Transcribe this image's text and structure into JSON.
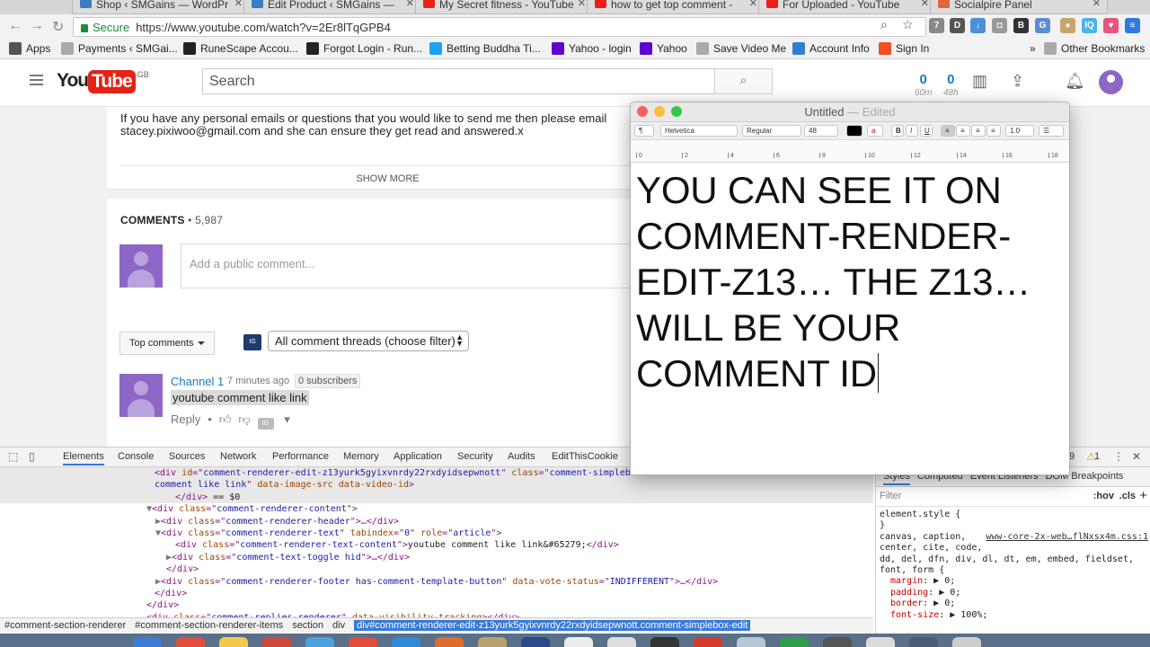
{
  "browser": {
    "tabs": [
      {
        "title": "Shop ‹ SMGains — WordPr",
        "favicon_color": "#3b7bbf"
      },
      {
        "title": "Edit Product ‹ SMGains —",
        "favicon_color": "#3b7bbf"
      },
      {
        "title": "My Secret fitness - YouTube",
        "favicon_color": "#e62117"
      },
      {
        "title": "how to get top comment -",
        "favicon_color": "#e62117"
      },
      {
        "title": "For Uploaded - YouTube",
        "favicon_color": "#e62117"
      },
      {
        "title": "Socialpire Panel",
        "favicon_color": "#e2643f"
      }
    ],
    "secure_label": "Secure",
    "url": "https://www.youtube.com/watch?v=2Er8lTqGPB4",
    "bookmarks": [
      {
        "label": "Apps",
        "icon": "apps-grid-icon",
        "color": "#555555"
      },
      {
        "label": "Payments ‹ SMGai...",
        "icon": "page-icon",
        "color": "#aaaaaa"
      },
      {
        "label": "RuneScape Accou...",
        "icon": "runescape-icon",
        "color": "#222222"
      },
      {
        "label": "Forgot Login - Run...",
        "icon": "runescape-icon",
        "color": "#222222"
      },
      {
        "label": "Betting Buddha Ti...",
        "icon": "twitter-icon",
        "color": "#1da1f2"
      },
      {
        "label": "Yahoo - login",
        "icon": "yahoo-icon",
        "color": "#5f01d1"
      },
      {
        "label": "Yahoo",
        "icon": "yahoo-icon",
        "color": "#5f01d1"
      },
      {
        "label": "Save Video Me",
        "icon": "page-icon",
        "color": "#aaaaaa"
      },
      {
        "label": "Account Info",
        "icon": "aol-icon",
        "color": "#2f80d1"
      },
      {
        "label": "Sign In",
        "icon": "microsoft-icon",
        "color": "#f25022"
      }
    ],
    "overflow_label": "»",
    "other_bookmarks": "Other Bookmarks"
  },
  "youtube": {
    "logo_you": "You",
    "logo_tube": "Tube",
    "logo_region": "GB",
    "search_placeholder": "Search",
    "stats": [
      {
        "value": "0",
        "label": "60m"
      },
      {
        "value": "0",
        "label": "48h"
      }
    ],
    "description": "If you have any personal emails or questions that you would like to send me then please email stacey.pixiwoo@gmail.com and she can ensure they get read and answered.x",
    "show_more": "SHOW MORE",
    "comments_label": "COMMENTS",
    "comments_count": " • 5,987",
    "add_comment_placeholder": "Add a public comment...",
    "sort_label": "Top comments",
    "filter_icon_text": "IG",
    "filter_label": "All comment threads (choose filter)",
    "comment": {
      "author": "Channel 1",
      "time": "7 minutes ago",
      "subscribers": "0 subscribers",
      "text": "youtube comment like link",
      "reply": "Reply",
      "separator": "•"
    },
    "colors": {
      "brand_red": "#e62117",
      "link_blue": "#167ac6",
      "avatar_purple": "#8e67c6"
    }
  },
  "devtools": {
    "tabs": [
      "Elements",
      "Console",
      "Sources",
      "Network",
      "Performance",
      "Memory",
      "Application",
      "Security",
      "Audits",
      "EditThisCookie"
    ],
    "warning_count": "1",
    "error_count": "9",
    "code_lines": [
      {
        "indent": 172,
        "parts": [
          [
            "tag",
            "<div "
          ],
          [
            "attr",
            "id"
          ],
          [
            "tag",
            "=\""
          ],
          [
            "val",
            "comment-renderer-edit-z13yurk5gyixvnrdy22rxdyidsepwnott"
          ],
          [
            "tag",
            "\" "
          ],
          [
            "attr",
            "class"
          ],
          [
            "tag",
            "=\""
          ],
          [
            "val",
            "comment-simplebox"
          ]
        ],
        "sel": true
      },
      {
        "indent": 172,
        "parts": [
          [
            "val",
            "comment like link"
          ],
          [
            "tag",
            "\" "
          ],
          [
            "attr",
            "data-image-src data-video-id"
          ],
          [
            "tag",
            ">"
          ]
        ],
        "sel": true
      },
      {
        "indent": 195,
        "parts": [
          [
            "tag",
            "</div>"
          ],
          [
            "txt",
            " == $0"
          ]
        ],
        "sel": true
      },
      {
        "indent": 163,
        "parts": [
          [
            "tri",
            "▼"
          ],
          [
            "tag",
            "<div "
          ],
          [
            "attr",
            "class"
          ],
          [
            "tag",
            "=\""
          ],
          [
            "val",
            "comment-renderer-content"
          ],
          [
            "tag",
            "\">"
          ]
        ]
      },
      {
        "indent": 173,
        "parts": [
          [
            "tri",
            "▶"
          ],
          [
            "tag",
            "<div "
          ],
          [
            "attr",
            "class"
          ],
          [
            "tag",
            "=\""
          ],
          [
            "val",
            "comment-renderer-header"
          ],
          [
            "tag",
            "\">…</div>"
          ]
        ]
      },
      {
        "indent": 173,
        "parts": [
          [
            "tri",
            "▼"
          ],
          [
            "tag",
            "<div "
          ],
          [
            "attr",
            "class"
          ],
          [
            "tag",
            "=\""
          ],
          [
            "val",
            "comment-renderer-text"
          ],
          [
            "tag",
            "\" "
          ],
          [
            "attr",
            "tabindex"
          ],
          [
            "tag",
            "=\""
          ],
          [
            "val",
            "0"
          ],
          [
            "tag",
            "\" "
          ],
          [
            "attr",
            "role"
          ],
          [
            "tag",
            "=\""
          ],
          [
            "val",
            "article"
          ],
          [
            "tag",
            "\">"
          ]
        ]
      },
      {
        "indent": 195,
        "parts": [
          [
            "tag",
            "<div "
          ],
          [
            "attr",
            "class"
          ],
          [
            "tag",
            "=\""
          ],
          [
            "val",
            "comment-renderer-text-content"
          ],
          [
            "tag",
            "\">"
          ],
          [
            "txt",
            "youtube comment like link&#65279;"
          ],
          [
            "tag",
            "</div>"
          ]
        ]
      },
      {
        "indent": 185,
        "parts": [
          [
            "tri",
            "▶"
          ],
          [
            "tag",
            "<div "
          ],
          [
            "attr",
            "class"
          ],
          [
            "tag",
            "=\""
          ],
          [
            "val",
            "comment-text-toggle hid"
          ],
          [
            "tag",
            "\">…</div>"
          ]
        ]
      },
      {
        "indent": 185,
        "parts": [
          [
            "tag",
            "</div>"
          ]
        ]
      },
      {
        "indent": 173,
        "parts": [
          [
            "tri",
            "▶"
          ],
          [
            "tag",
            "<div "
          ],
          [
            "attr",
            "class"
          ],
          [
            "tag",
            "=\""
          ],
          [
            "val",
            "comment-renderer-footer has-comment-template-button"
          ],
          [
            "tag",
            "\" "
          ],
          [
            "attr",
            "data-vote-status"
          ],
          [
            "tag",
            "=\""
          ],
          [
            "val",
            "INDIFFERENT"
          ],
          [
            "tag",
            "\">…</div>"
          ]
        ]
      },
      {
        "indent": 172,
        "parts": [
          [
            "tag",
            "</div>"
          ]
        ]
      },
      {
        "indent": 163,
        "parts": [
          [
            "tag",
            "</div>"
          ]
        ]
      },
      {
        "indent": 163,
        "parts": [
          [
            "tag",
            "<div "
          ],
          [
            "attr",
            "class"
          ],
          [
            "tag",
            "=\""
          ],
          [
            "val",
            "comment-replies-renderer"
          ],
          [
            "tag",
            "\" "
          ],
          [
            "attr",
            "data-visibility-tracking"
          ],
          [
            "tag",
            "></div>"
          ]
        ]
      }
    ],
    "right_tabs": [
      "Styles",
      "Computed",
      "Event Listeners",
      "DOM Breakpoints"
    ],
    "filter_placeholder": "Filter",
    "hov": ":hov",
    "cls": ".cls",
    "style_lines": [
      {
        "text": "element.style {"
      },
      {
        "text": "}"
      },
      {
        "text": "canvas, caption,",
        "src": "www-core-2x-web…flNxsx4m.css:1"
      },
      {
        "text": "center, cite, code,"
      },
      {
        "text": "dd, del, dfn, div, dl, dt, em, embed, fieldset,"
      },
      {
        "text": "font, form {"
      },
      {
        "prop": "margin",
        "val": "0;"
      },
      {
        "prop": "padding",
        "val": "0;"
      },
      {
        "prop": "border",
        "val": "0;"
      },
      {
        "prop": "font-size",
        "val": "100%;"
      }
    ],
    "breadcrumbs": [
      "#comment-section-renderer",
      "#comment-section-renderer-items",
      "section",
      "div"
    ],
    "breadcrumb_current": "div#comment-renderer-edit-z13yurk5gyixvnrdy22rxdyidsepwnott.comment-simplebox-edit"
  },
  "textedit": {
    "title": "Untitled",
    "edited": "— Edited",
    "paragraph_style": "¶",
    "font_family": "Helvetica",
    "font_style": "Regular",
    "font_size": "48",
    "line_spacing": "1.0",
    "bold": "B",
    "italic": "I",
    "underline": "U",
    "ruler_numbers": [
      "0",
      "2",
      "4",
      "6",
      "8",
      "10",
      "12",
      "14",
      "16",
      "18"
    ],
    "document_text": "YOU CAN SEE IT ON COMMENT-RENDER-EDIT-Z13… THE Z13… WILL BE YOUR COMMENT ID"
  }
}
